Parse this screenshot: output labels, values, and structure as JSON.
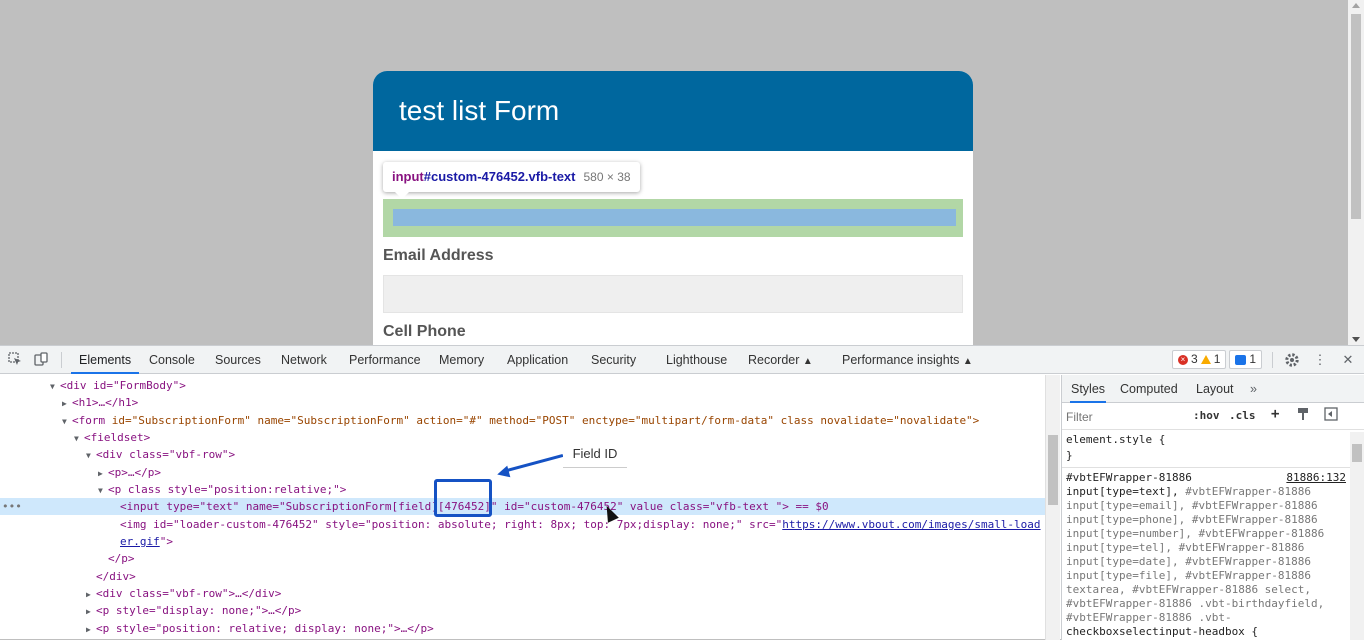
{
  "form": {
    "title": "test list Form",
    "fields": [
      {
        "label": "Email Address"
      },
      {
        "label": "Cell Phone"
      }
    ]
  },
  "tooltip": {
    "tag": "input",
    "selector": "#custom-476452.vfb-text",
    "dims": "580 × 38"
  },
  "devtools": {
    "tabs": [
      "Elements",
      "Console",
      "Sources",
      "Network",
      "Performance",
      "Memory",
      "Application",
      "Security",
      "Lighthouse",
      "Recorder",
      "Performance insights"
    ],
    "active_tab": "Elements",
    "badges": {
      "errors": "3",
      "warnings": "1",
      "messages": "1"
    },
    "annotation": "Field ID",
    "styles_tabs": [
      "Styles",
      "Computed",
      "Layout"
    ],
    "filter_placeholder": "Filter",
    "tools": {
      "hov": ":hov",
      "cls": ".cls"
    },
    "element_style": "element.style {",
    "close_brace": "}",
    "rule_selector": "#vbtEFWrapper-81886",
    "rule_source": "81886:132",
    "rule_lines": [
      [
        "input[type=text], ",
        "#vbtEFWrapper-81886"
      ],
      [
        "input[type=email], ",
        "#vbtEFWrapper-81886"
      ],
      [
        "input[type=phone], ",
        "#vbtEFWrapper-81886"
      ],
      [
        "input[type=number], ",
        "#vbtEFWrapper-81886"
      ],
      [
        "input[type=tel], ",
        "#vbtEFWrapper-81886"
      ],
      [
        "input[type=date], ",
        "#vbtEFWrapper-81886"
      ],
      [
        "input[type=file], ",
        "#vbtEFWrapper-81886"
      ],
      [
        "textarea, ",
        "#vbtEFWrapper-81886 select,"
      ],
      [
        "",
        "#vbtEFWrapper-81886 .vbt-birthdayfield,"
      ],
      [
        "",
        "#vbtEFWrapper-81886 .vbt-"
      ],
      [
        "checkboxselectinput-headbox {",
        ""
      ]
    ]
  },
  "dom_lines": {
    "l0": "<div id=\"FormBody\">",
    "l1": "<h1>…</h1>",
    "l2_a": "<form ",
    "l2_b": "id=\"SubscriptionForm\" name=\"SubscriptionForm\" action=\"#\" method=\"POST\" enctype=\"multipart/form-data\" class novalidate=\"novalidate\">",
    "l3": "<fieldset>",
    "l4": "<div class=\"vbf-row\">",
    "l5": "<p>…</p>",
    "l6": "<p class style=\"position:relative;\">",
    "l7": "<input type=\"text\" name=\"SubscriptionForm[field][476452]\" id=\"custom-476452\" value class=\"vfb-text   \"> == $0",
    "l8": "<img id=\"loader-custom-476452\" style=\"position: absolute; right: 8px; top: 7px;display: none;\" src=\"",
    "l8_link": "https://www.vbout.com/images/small-load",
    "l9_link": "er.gif",
    "l9": "\">",
    "l10": "</p>",
    "l11": "</div>",
    "l12": "<div class=\"vbf-row\">…</div>",
    "l13": "<p style=\"display: none;\">…</p>",
    "l14": "<p style=\"position: relative; display: none;\">…</p>"
  }
}
